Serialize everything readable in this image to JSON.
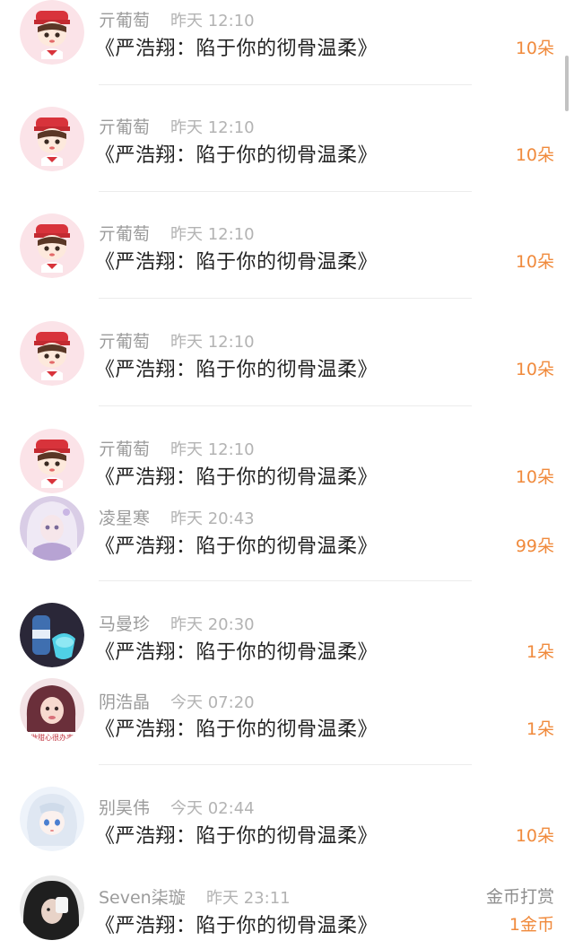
{
  "records": [
    {
      "name": "亓葡萄",
      "time": "昨天 12:10",
      "title": "《严浩翔：陷于你的彻骨温柔》",
      "gift": "10朵",
      "avatar": "cartoon-avatar-icon"
    },
    {
      "name": "亓葡萄",
      "time": "昨天 12:10",
      "title": "《严浩翔：陷于你的彻骨温柔》",
      "gift": "10朵",
      "avatar": "cartoon-avatar-icon"
    },
    {
      "name": "亓葡萄",
      "time": "昨天 12:10",
      "title": "《严浩翔：陷于你的彻骨温柔》",
      "gift": "10朵",
      "avatar": "cartoon-avatar-icon"
    },
    {
      "name": "亓葡萄",
      "time": "昨天 12:10",
      "title": "《严浩翔：陷于你的彻骨温柔》",
      "gift": "10朵",
      "avatar": "cartoon-avatar-icon"
    },
    {
      "name": "亓葡萄",
      "time": "昨天 12:10",
      "title": "《严浩翔：陷于你的彻骨温柔》",
      "gift": "10朵",
      "avatar": "cartoon-avatar-icon"
    },
    {
      "name": "凌星寒",
      "time": "昨天 20:43",
      "title": "《严浩翔：陷于你的彻骨温柔》",
      "gift": "99朵",
      "avatar": "doll-avatar-icon"
    },
    {
      "name": "马曼珍",
      "time": "昨天 20:30",
      "title": "《严浩翔：陷于你的彻骨温柔》",
      "gift": "1朵",
      "avatar": "bottle-avatar-icon"
    },
    {
      "name": "阴浩晶",
      "time": "今天 07:20",
      "title": "《严浩翔：陷于你的彻骨温柔》",
      "gift": "1朵",
      "avatar": "photo-avatar-icon",
      "avatar_text": "做甜心很办事"
    },
    {
      "name": "别昊伟",
      "time": "今天 02:44",
      "title": "《严浩翔：陷于你的彻骨温柔》",
      "gift": "10朵",
      "avatar": "anime-avatar-icon"
    },
    {
      "name": "Seven柒璇",
      "time": "昨天 23:11",
      "title": "《严浩翔：陷于你的彻骨温柔》",
      "gift": "1金币",
      "gift_type": "金币打赏",
      "avatar": "dark-photo-avatar-icon"
    }
  ],
  "colors": {
    "gift": "#f08a3c",
    "name": "#9b9b9b",
    "title": "#222222",
    "divider": "#ececec"
  }
}
